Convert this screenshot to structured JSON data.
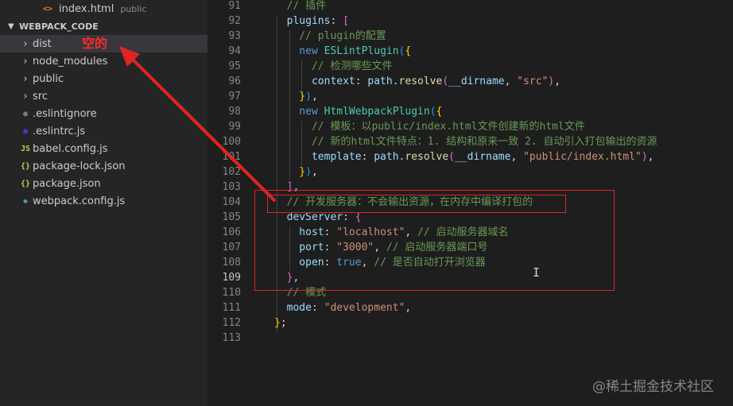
{
  "explorer": {
    "top_file": {
      "name": "index.html",
      "description": "public",
      "icon": "html-file-icon",
      "icon_color": "#e37933"
    },
    "section_title": "WEBPACK_CODE",
    "items": [
      {
        "name": "dist",
        "type": "folder"
      },
      {
        "name": "node_modules",
        "type": "folder"
      },
      {
        "name": "public",
        "type": "folder"
      },
      {
        "name": "src",
        "type": "folder"
      },
      {
        "name": ".eslintignore",
        "type": "file",
        "icon": "eslint-ignore-icon",
        "icon_glyph": "●",
        "icon_color": "#6d8086"
      },
      {
        "name": ".eslintrc.js",
        "type": "file",
        "icon": "eslint-icon",
        "icon_glyph": "●",
        "icon_color": "#4b32c3"
      },
      {
        "name": "babel.config.js",
        "type": "file",
        "icon": "js-file-icon",
        "icon_glyph": "JS",
        "icon_color": "#cbcb41"
      },
      {
        "name": "package-lock.json",
        "type": "file",
        "icon": "json-file-icon",
        "icon_glyph": "{}",
        "icon_color": "#cbcb41"
      },
      {
        "name": "package.json",
        "type": "file",
        "icon": "json-file-icon",
        "icon_glyph": "{}",
        "icon_color": "#cbcb41"
      },
      {
        "name": "webpack.config.js",
        "type": "file",
        "icon": "webpack-icon",
        "icon_glyph": "◆",
        "icon_color": "#519aba"
      }
    ]
  },
  "annotation": {
    "label": "空的",
    "color": "#ff2a2a"
  },
  "editor": {
    "active_line": "109",
    "lines": [
      {
        "n": "91",
        "tokens": [
          [
            "c-com",
            "  // 插件"
          ]
        ]
      },
      {
        "n": "92",
        "tokens": [
          [
            "c-key",
            "  plugins"
          ],
          [
            "",
            ": "
          ],
          [
            "c-br1",
            "["
          ]
        ]
      },
      {
        "n": "93",
        "tokens": [
          [
            "c-com",
            "    // plugin的配置"
          ]
        ]
      },
      {
        "n": "94",
        "tokens": [
          [
            "c-blue",
            "    new "
          ],
          [
            "c-cls",
            "ESLintPlugin"
          ],
          [
            "c-br3",
            "("
          ],
          [
            "c-br2",
            "{"
          ]
        ]
      },
      {
        "n": "95",
        "tokens": [
          [
            "c-com",
            "      // 检测哪些文件"
          ]
        ]
      },
      {
        "n": "96",
        "tokens": [
          [
            "c-key",
            "      context"
          ],
          [
            "",
            ": "
          ],
          [
            "c-key",
            "path"
          ],
          [
            "",
            "."
          ],
          [
            "c-fn",
            "resolve"
          ],
          [
            "c-br1",
            "("
          ],
          [
            "c-key",
            "__dirname"
          ],
          [
            "",
            ", "
          ],
          [
            "c-str",
            "\"src\""
          ],
          [
            "c-br1",
            ")"
          ],
          [
            "",
            ","
          ]
        ]
      },
      {
        "n": "97",
        "tokens": [
          [
            "c-br2",
            "    }"
          ],
          [
            "c-br3",
            ")"
          ],
          [
            "",
            ","
          ]
        ]
      },
      {
        "n": "98",
        "tokens": [
          [
            "c-blue",
            "    new "
          ],
          [
            "c-cls",
            "HtmlWebpackPlugin"
          ],
          [
            "c-br3",
            "("
          ],
          [
            "c-br2",
            "{"
          ]
        ]
      },
      {
        "n": "99",
        "tokens": [
          [
            "c-com",
            "      // 模板：以public/index.html文件创建新的html文件"
          ]
        ]
      },
      {
        "n": "100",
        "tokens": [
          [
            "c-com",
            "      // 新的html文件特点：1. 结构和原来一致 2. 自动引入打包输出的资源"
          ]
        ]
      },
      {
        "n": "101",
        "tokens": [
          [
            "c-key",
            "      template"
          ],
          [
            "",
            ": "
          ],
          [
            "c-key",
            "path"
          ],
          [
            "",
            "."
          ],
          [
            "c-fn",
            "resolve"
          ],
          [
            "c-br1",
            "("
          ],
          [
            "c-key",
            "__dirname"
          ],
          [
            "",
            ", "
          ],
          [
            "c-str",
            "\"public/index.html\""
          ],
          [
            "c-br1",
            ")"
          ],
          [
            "",
            ","
          ]
        ]
      },
      {
        "n": "102",
        "tokens": [
          [
            "c-br2",
            "    }"
          ],
          [
            "c-br3",
            ")"
          ],
          [
            "",
            ","
          ]
        ]
      },
      {
        "n": "103",
        "tokens": [
          [
            "c-br1",
            "  ]"
          ],
          [
            "",
            ","
          ]
        ]
      },
      {
        "n": "104",
        "tokens": [
          [
            "c-com",
            "  // 开发服务器：不会输出资源，在内存中编译打包的"
          ]
        ]
      },
      {
        "n": "105",
        "tokens": [
          [
            "c-key",
            "  devServer"
          ],
          [
            "",
            ": "
          ],
          [
            "c-br1",
            "{"
          ]
        ]
      },
      {
        "n": "106",
        "tokens": [
          [
            "c-key",
            "    host"
          ],
          [
            "",
            ": "
          ],
          [
            "c-str",
            "\"localhost\""
          ],
          [
            "",
            ", "
          ],
          [
            "c-com",
            "// 启动服务器域名"
          ]
        ]
      },
      {
        "n": "107",
        "tokens": [
          [
            "c-key",
            "    port"
          ],
          [
            "",
            ": "
          ],
          [
            "c-str",
            "\"3000\""
          ],
          [
            "",
            ", "
          ],
          [
            "c-com",
            "// 启动服务器端口号"
          ]
        ]
      },
      {
        "n": "108",
        "tokens": [
          [
            "c-key",
            "    open"
          ],
          [
            "",
            ": "
          ],
          [
            "c-blue",
            "true"
          ],
          [
            "",
            ", "
          ],
          [
            "c-com",
            "// 是否自动打开浏览器"
          ]
        ]
      },
      {
        "n": "109",
        "tokens": [
          [
            "c-br1",
            "  }"
          ],
          [
            "",
            ","
          ]
        ]
      },
      {
        "n": "110",
        "tokens": [
          [
            "c-com",
            "  // 模式"
          ]
        ]
      },
      {
        "n": "111",
        "tokens": [
          [
            "c-key",
            "  mode"
          ],
          [
            "",
            ": "
          ],
          [
            "c-str",
            "\"development\""
          ],
          [
            "",
            ","
          ]
        ]
      },
      {
        "n": "112",
        "tokens": [
          [
            "c-br2",
            "}"
          ],
          [
            "",
            ";"
          ]
        ]
      },
      {
        "n": "113",
        "tokens": []
      }
    ]
  },
  "watermark": "@稀土掘金技术社区",
  "colors": {
    "annotation_red": "#e02424",
    "sidebar_bg": "#252526",
    "editor_bg": "#1e1e1e"
  }
}
